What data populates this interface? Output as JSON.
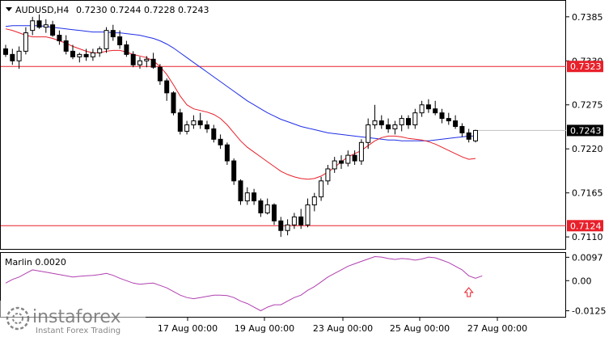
{
  "header": {
    "symbol": "AUDUSD,H4",
    "ohlc": "0.7230 0.7244 0.7228 0.7243"
  },
  "indicator": {
    "label": "Marlin 0.0020",
    "ticks": [
      "0.0097",
      "0.00",
      "-0.0125"
    ]
  },
  "price_ticks": [
    "0.7385",
    "0.7330",
    "0.7275",
    "0.7220",
    "0.7165",
    "0.7110"
  ],
  "time_ticks": [
    "17 Aug 00:00",
    "19 Aug 00:00",
    "23 Aug 00:00",
    "25 Aug 00:00",
    "27 Aug 00:00"
  ],
  "level_labels": {
    "upper": "0.7323",
    "lower": "0.7124",
    "current": "0.7243"
  },
  "watermark": {
    "brand": "instaforex",
    "tagline": "Instant Forex Trading"
  },
  "colors": {
    "level_line": "#e8202a",
    "ma_fast": "#e8202a",
    "ma_slow": "#1e2ee6",
    "oscillator": "#b040b0",
    "arrow": "#e8202a"
  },
  "chart_data": {
    "type": "candlestick",
    "symbol": "AUDUSD",
    "timeframe": "H4",
    "ylim": [
      0.7095,
      0.7405
    ],
    "horizontal_levels": [
      0.7323,
      0.7124
    ],
    "current_price": 0.7243,
    "candles": [
      [
        0.7345,
        0.735,
        0.7335,
        0.7338
      ],
      [
        0.7338,
        0.7345,
        0.7325,
        0.733
      ],
      [
        0.733,
        0.7348,
        0.732,
        0.7342
      ],
      [
        0.7342,
        0.7372,
        0.7338,
        0.7365
      ],
      [
        0.7368,
        0.7385,
        0.7362,
        0.738
      ],
      [
        0.738,
        0.7388,
        0.737,
        0.7372
      ],
      [
        0.7372,
        0.7382,
        0.7365,
        0.7375
      ],
      [
        0.7375,
        0.738,
        0.736,
        0.7362
      ],
      [
        0.7362,
        0.7368,
        0.735,
        0.7355
      ],
      [
        0.7355,
        0.7362,
        0.7338,
        0.7342
      ],
      [
        0.7342,
        0.735,
        0.7332,
        0.7335
      ],
      [
        0.7335,
        0.734,
        0.7328,
        0.7338
      ],
      [
        0.7338,
        0.7345,
        0.733,
        0.7335
      ],
      [
        0.7335,
        0.7345,
        0.733,
        0.734
      ],
      [
        0.734,
        0.7348,
        0.7335,
        0.7345
      ],
      [
        0.7345,
        0.7372,
        0.734,
        0.7368
      ],
      [
        0.7368,
        0.7375,
        0.7355,
        0.736
      ],
      [
        0.736,
        0.7368,
        0.7345,
        0.735
      ],
      [
        0.735,
        0.7355,
        0.7335,
        0.7338
      ],
      [
        0.7338,
        0.7342,
        0.7322,
        0.7325
      ],
      [
        0.7325,
        0.7335,
        0.732,
        0.733
      ],
      [
        0.733,
        0.7336,
        0.7322,
        0.7332
      ],
      [
        0.7332,
        0.734,
        0.732,
        0.7322
      ],
      [
        0.7322,
        0.7326,
        0.73,
        0.7305
      ],
      [
        0.7305,
        0.7308,
        0.728,
        0.729
      ],
      [
        0.729,
        0.7292,
        0.7262,
        0.7265
      ],
      [
        0.7265,
        0.727,
        0.7238,
        0.7242
      ],
      [
        0.7242,
        0.7255,
        0.7238,
        0.725
      ],
      [
        0.725,
        0.7262,
        0.7245,
        0.7255
      ],
      [
        0.7255,
        0.7265,
        0.7245,
        0.725
      ],
      [
        0.725,
        0.7255,
        0.724,
        0.7245
      ],
      [
        0.7245,
        0.725,
        0.7228,
        0.7232
      ],
      [
        0.7232,
        0.7238,
        0.722,
        0.7225
      ],
      [
        0.7225,
        0.7228,
        0.72,
        0.7205
      ],
      [
        0.7205,
        0.7208,
        0.7175,
        0.718
      ],
      [
        0.718,
        0.7182,
        0.715,
        0.7155
      ],
      [
        0.7155,
        0.7172,
        0.715,
        0.7165
      ],
      [
        0.7165,
        0.717,
        0.715,
        0.7155
      ],
      [
        0.7155,
        0.7158,
        0.7135,
        0.714
      ],
      [
        0.714,
        0.7158,
        0.7138,
        0.715
      ],
      [
        0.715,
        0.7152,
        0.7125,
        0.713
      ],
      [
        0.713,
        0.7135,
        0.711,
        0.7118
      ],
      [
        0.7118,
        0.7132,
        0.7112,
        0.7125
      ],
      [
        0.7125,
        0.714,
        0.712,
        0.7135
      ],
      [
        0.7135,
        0.7145,
        0.712,
        0.7125
      ],
      [
        0.7125,
        0.7158,
        0.7122,
        0.715
      ],
      [
        0.715,
        0.7165,
        0.7142,
        0.716
      ],
      [
        0.716,
        0.7185,
        0.7155,
        0.718
      ],
      [
        0.718,
        0.72,
        0.7175,
        0.7195
      ],
      [
        0.7195,
        0.721,
        0.719,
        0.7205
      ],
      [
        0.7205,
        0.7212,
        0.7195,
        0.7202
      ],
      [
        0.7202,
        0.7218,
        0.7198,
        0.7212
      ],
      [
        0.7212,
        0.7218,
        0.72,
        0.7205
      ],
      [
        0.7205,
        0.7232,
        0.72,
        0.7228
      ],
      [
        0.7228,
        0.7258,
        0.722,
        0.725
      ],
      [
        0.725,
        0.7275,
        0.7245,
        0.7255
      ],
      [
        0.7255,
        0.7262,
        0.7245,
        0.725
      ],
      [
        0.725,
        0.7258,
        0.724,
        0.7245
      ],
      [
        0.7245,
        0.7255,
        0.7238,
        0.725
      ],
      [
        0.725,
        0.7262,
        0.7242,
        0.7258
      ],
      [
        0.7258,
        0.7262,
        0.7245,
        0.725
      ],
      [
        0.725,
        0.727,
        0.7245,
        0.7265
      ],
      [
        0.7265,
        0.728,
        0.726,
        0.7275
      ],
      [
        0.7275,
        0.7282,
        0.7265,
        0.727
      ],
      [
        0.727,
        0.728,
        0.7262,
        0.7265
      ],
      [
        0.7265,
        0.727,
        0.7252,
        0.7258
      ],
      [
        0.7258,
        0.7265,
        0.725,
        0.7255
      ],
      [
        0.7255,
        0.7262,
        0.7245,
        0.7248
      ],
      [
        0.7248,
        0.7252,
        0.7235,
        0.724
      ],
      [
        0.724,
        0.7245,
        0.7228,
        0.7232
      ],
      [
        0.723,
        0.7244,
        0.7228,
        0.7243
      ]
    ],
    "ma_fast": [
      0.737,
      0.7368,
      0.7365,
      0.7362,
      0.736,
      0.736,
      0.736,
      0.7358,
      0.7355,
      0.7352,
      0.7348,
      0.7345,
      0.7342,
      0.734,
      0.734,
      0.7342,
      0.7343,
      0.7343,
      0.7341,
      0.7338,
      0.7336,
      0.7334,
      0.733,
      0.7323,
      0.7313,
      0.73,
      0.7286,
      0.7275,
      0.727,
      0.7268,
      0.7266,
      0.7263,
      0.7258,
      0.725,
      0.724,
      0.723,
      0.7222,
      0.7216,
      0.721,
      0.7204,
      0.7198,
      0.7192,
      0.7188,
      0.7185,
      0.7183,
      0.7182,
      0.7183,
      0.7186,
      0.7191,
      0.7197,
      0.7204,
      0.721,
      0.7214,
      0.7218,
      0.7224,
      0.723,
      0.7234,
      0.7236,
      0.7236,
      0.7235,
      0.7233,
      0.7232,
      0.7231,
      0.7229,
      0.7226,
      0.7222,
      0.7218,
      0.7214,
      0.721,
      0.7207,
      0.7208
    ],
    "ma_slow": [
      0.7373,
      0.7374,
      0.7374,
      0.7374,
      0.7374,
      0.7374,
      0.7373,
      0.7372,
      0.7371,
      0.737,
      0.7369,
      0.7368,
      0.7367,
      0.7366,
      0.7366,
      0.7366,
      0.7365,
      0.7365,
      0.7364,
      0.7363,
      0.7362,
      0.736,
      0.7358,
      0.7355,
      0.7351,
      0.7346,
      0.734,
      0.7334,
      0.7328,
      0.7322,
      0.7316,
      0.731,
      0.7304,
      0.7298,
      0.7292,
      0.7286,
      0.728,
      0.7275,
      0.727,
      0.7265,
      0.7261,
      0.7257,
      0.7254,
      0.7251,
      0.7248,
      0.7246,
      0.7244,
      0.7242,
      0.724,
      0.7239,
      0.7238,
      0.7237,
      0.7236,
      0.7235,
      0.7234,
      0.7233,
      0.7232,
      0.7231,
      0.7231,
      0.723,
      0.723,
      0.723,
      0.723,
      0.723,
      0.7231,
      0.7232,
      0.7233,
      0.7234,
      0.7235,
      0.7236,
      0.7236
    ],
    "oscillator": {
      "name": "Marlin",
      "ylim": [
        -0.015,
        0.0115
      ],
      "values": [
        -0.001,
        0.0005,
        0.0015,
        0.003,
        0.0045,
        0.004,
        0.0035,
        0.003,
        0.0025,
        0.002,
        0.0015,
        0.0018,
        0.002,
        0.0022,
        0.0025,
        0.003,
        0.0022,
        0.001,
        0.0,
        -0.001,
        -0.0015,
        -0.0012,
        -0.001,
        -0.002,
        -0.003,
        -0.0045,
        -0.006,
        -0.007,
        -0.0075,
        -0.007,
        -0.0065,
        -0.006,
        -0.006,
        -0.0062,
        -0.007,
        -0.0085,
        -0.0095,
        -0.011,
        -0.0125,
        -0.011,
        -0.01,
        -0.01,
        -0.0085,
        -0.007,
        -0.006,
        -0.004,
        -0.0025,
        -0.0005,
        0.0015,
        0.003,
        0.0045,
        0.006,
        0.007,
        0.008,
        0.009,
        0.01,
        0.0098,
        0.0092,
        0.0088,
        0.0092,
        0.009,
        0.0085,
        0.009,
        0.0098,
        0.0095,
        0.0085,
        0.0075,
        0.006,
        0.0045,
        0.002,
        0.001,
        0.002
      ],
      "arrow_at_index": 69
    }
  }
}
